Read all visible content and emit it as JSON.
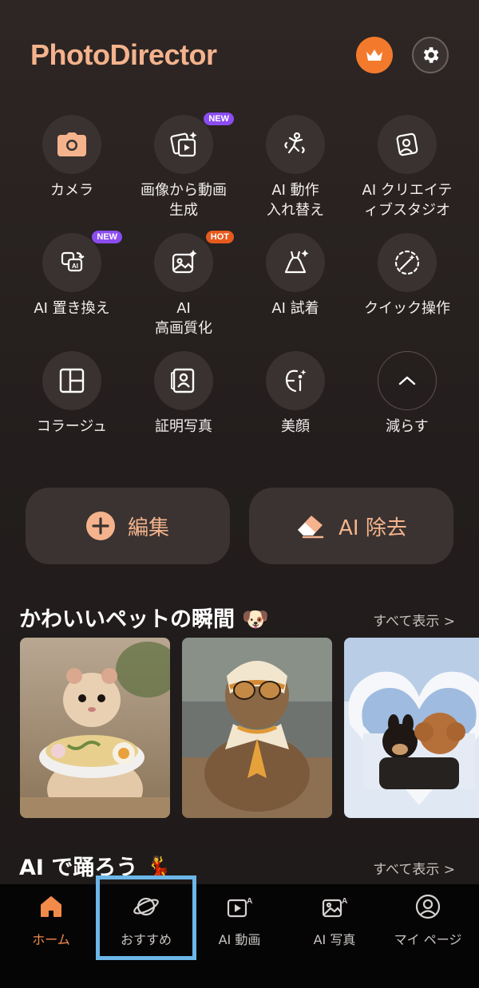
{
  "header": {
    "title": "PhotoDirector"
  },
  "tools": [
    {
      "label": "カメラ",
      "icon": "camera-icon"
    },
    {
      "label": "画像から動画\n生成",
      "icon": "image-to-video-icon",
      "badge": "NEW"
    },
    {
      "label": "AI 動作\n入れ替え",
      "icon": "dance-swap-icon"
    },
    {
      "label": "AI クリエイテ\nィブスタジオ",
      "icon": "creative-studio-icon"
    },
    {
      "label": "AI 置き換え",
      "icon": "ai-replace-icon",
      "badge": "NEW"
    },
    {
      "label": "AI\n高画質化",
      "icon": "enhance-icon",
      "badge": "HOT"
    },
    {
      "label": "AI 試着",
      "icon": "dress-icon"
    },
    {
      "label": "クイック操作",
      "icon": "magic-wand-icon"
    },
    {
      "label": "コラージュ",
      "icon": "collage-icon"
    },
    {
      "label": "証明写真",
      "icon": "id-photo-icon"
    },
    {
      "label": "美顔",
      "icon": "face-beauty-icon"
    },
    {
      "label": "減らす",
      "icon": "chevron-up-icon"
    }
  ],
  "actions": {
    "edit": "編集",
    "remove": "AI 除去"
  },
  "sections": {
    "pets": {
      "title": "かわいいペットの瞬間 🐶",
      "see_all": "すべて表示 >"
    },
    "dance": {
      "title": "AI で踊ろう 💃",
      "see_all": "すべて表示 >"
    }
  },
  "nav": [
    {
      "label": "ホーム",
      "icon": "home-icon",
      "active": true
    },
    {
      "label": "おすすめ",
      "icon": "planet-icon"
    },
    {
      "label": "AI 動画",
      "icon": "ai-video-icon"
    },
    {
      "label": "AI 写真",
      "icon": "ai-photo-icon"
    },
    {
      "label": "マイ ページ",
      "icon": "profile-icon"
    }
  ],
  "colors": {
    "accent": "#f4b38d",
    "premium": "#f37a2c",
    "new_badge": "#8b4cf0",
    "hot_badge": "#e75a1e",
    "nav_active": "#f28a4a",
    "highlight": "#6cb6e8"
  }
}
